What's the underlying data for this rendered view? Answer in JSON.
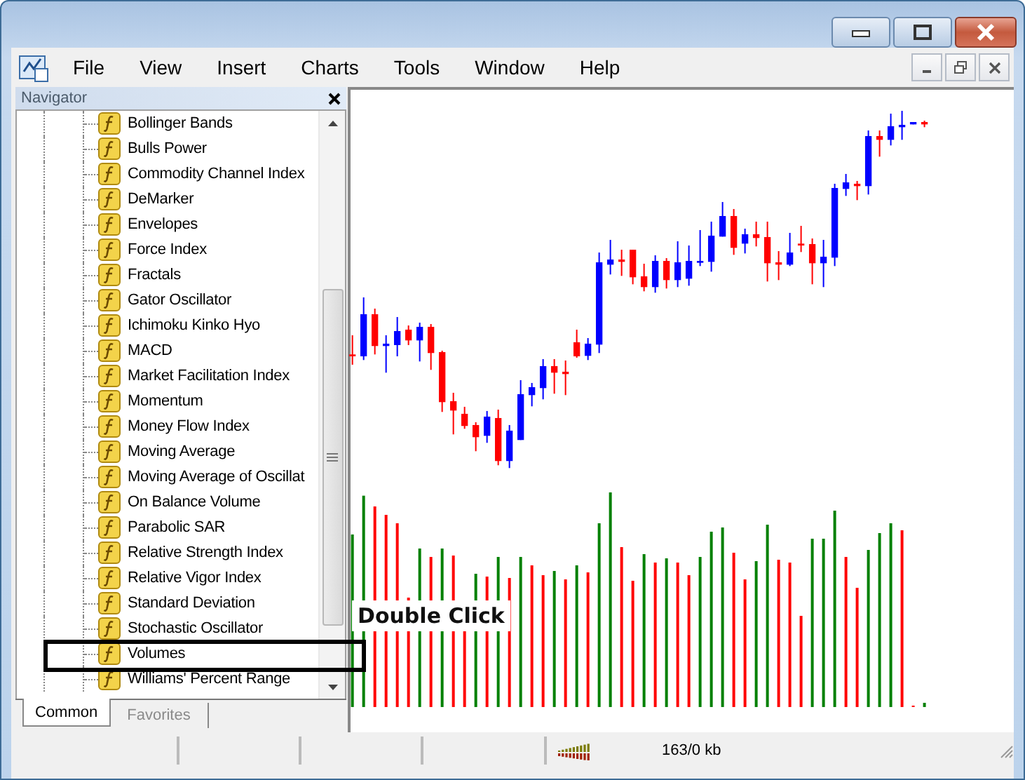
{
  "menu": [
    "File",
    "View",
    "Insert",
    "Charts",
    "Tools",
    "Window",
    "Help"
  ],
  "navigator": {
    "title": "Navigator",
    "items": [
      {
        "label": "Bollinger Bands"
      },
      {
        "label": "Bulls Power"
      },
      {
        "label": "Commodity Channel Index"
      },
      {
        "label": "DeMarker"
      },
      {
        "label": "Envelopes"
      },
      {
        "label": "Force Index"
      },
      {
        "label": "Fractals"
      },
      {
        "label": "Gator Oscillator"
      },
      {
        "label": "Ichimoku Kinko Hyo"
      },
      {
        "label": "MACD"
      },
      {
        "label": "Market Facilitation Index"
      },
      {
        "label": "Momentum"
      },
      {
        "label": "Money Flow Index"
      },
      {
        "label": "Moving Average"
      },
      {
        "label": "Moving Average of Oscillat"
      },
      {
        "label": "On Balance Volume"
      },
      {
        "label": "Parabolic SAR"
      },
      {
        "label": "Relative Strength Index"
      },
      {
        "label": "Relative Vigor Index"
      },
      {
        "label": "Standard Deviation"
      },
      {
        "label": "Stochastic Oscillator"
      },
      {
        "label": "Volumes",
        "highlighted": true
      },
      {
        "label": "Williams' Percent Range"
      }
    ],
    "tabs": [
      {
        "label": "Common",
        "selected": true
      },
      {
        "label": "Favorites",
        "selected": false
      }
    ]
  },
  "annotation": {
    "text": "Double Click"
  },
  "status_bar": {
    "traffic": "163/0 kb"
  }
}
